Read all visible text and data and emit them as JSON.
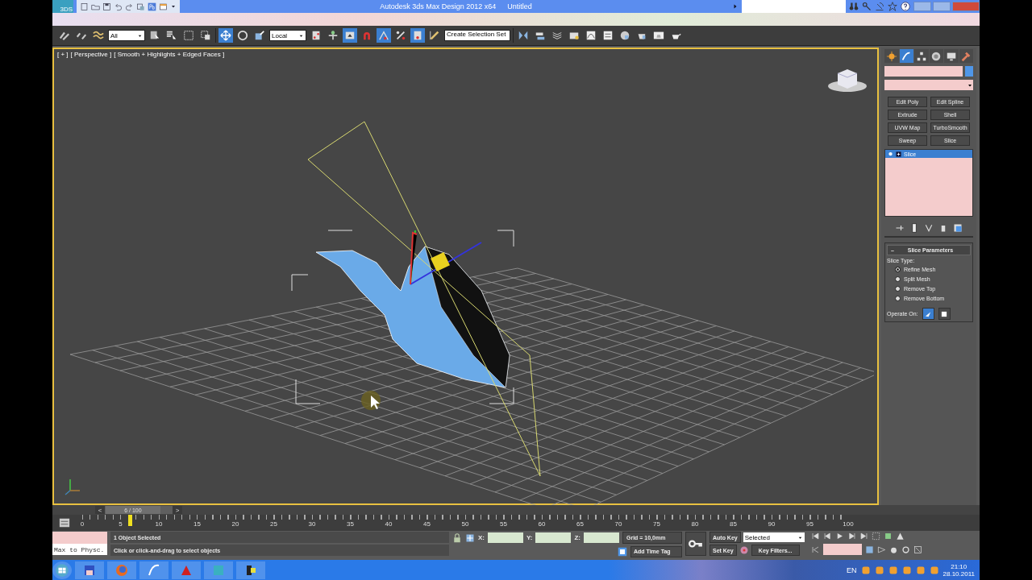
{
  "title_bar": {
    "app_badge": "3DS",
    "title": "Autodesk 3ds Max Design 2012 x64",
    "document": "Untitled"
  },
  "main_toolbar": {
    "selection_filter": "All",
    "reference_coordinate": "Local",
    "named_selection": "Create Selection Set"
  },
  "viewport": {
    "labels": [
      "[ + ]",
      "[ Perspective ]",
      "[ Smooth + Highlights + Edged Faces ]"
    ]
  },
  "command_panel": {
    "tabs": [
      {
        "kind": "create",
        "selected": false
      },
      {
        "kind": "modify",
        "selected": true
      },
      {
        "kind": "hierarchy",
        "selected": false
      },
      {
        "kind": "motion",
        "selected": false
      },
      {
        "kind": "display",
        "selected": false
      },
      {
        "kind": "utilities",
        "selected": false
      }
    ],
    "modifier_buttons": [
      "Edit Poly",
      "Edit Spline",
      "Extrude",
      "Shell",
      "UVW Map",
      "TurboSmooth",
      "Sweep",
      "Slice"
    ],
    "stack": [
      {
        "label": "Slice",
        "selected": true
      }
    ],
    "rollout": {
      "toggle": "–",
      "title": "Slice Parameters",
      "slice_type_label": "Slice Type:",
      "options": [
        {
          "label": "Refine Mesh",
          "selected": true
        },
        {
          "label": "Split Mesh",
          "selected": false
        },
        {
          "label": "Remove Top",
          "selected": false
        },
        {
          "label": "Remove Bottom",
          "selected": false
        }
      ],
      "operate_on_label": "Operate On:",
      "operate_on": [
        {
          "kind": "faces",
          "selected": true
        },
        {
          "kind": "polygons",
          "selected": false
        }
      ]
    }
  },
  "time_slider": {
    "prev": "<",
    "frame": "6 / 100",
    "next": ">"
  },
  "track_bar": {
    "ticks": [
      "0",
      "5",
      "10",
      "15",
      "20",
      "25",
      "30",
      "35",
      "40",
      "45",
      "50",
      "55",
      "60",
      "65",
      "70",
      "75",
      "80",
      "85",
      "90",
      "95",
      "100"
    ],
    "level": 0.06
  },
  "status_bar": {
    "script_listener": "Max to Physc.",
    "selection_status": "1 Object Selected",
    "prompt": "Click or click-and-drag to select objects",
    "coords": [
      "X:",
      "Y:",
      "Z:"
    ],
    "grid": "Grid = 10,0mm",
    "add_time_tag": "Add Time Tag",
    "auto_key": "Auto Key",
    "key_mode": "Selected",
    "set_key": "Set Key",
    "key_filters": "Key Filters..."
  },
  "taskbar": {
    "language": "EN",
    "time": "21:10",
    "date": "28.10.2011"
  }
}
